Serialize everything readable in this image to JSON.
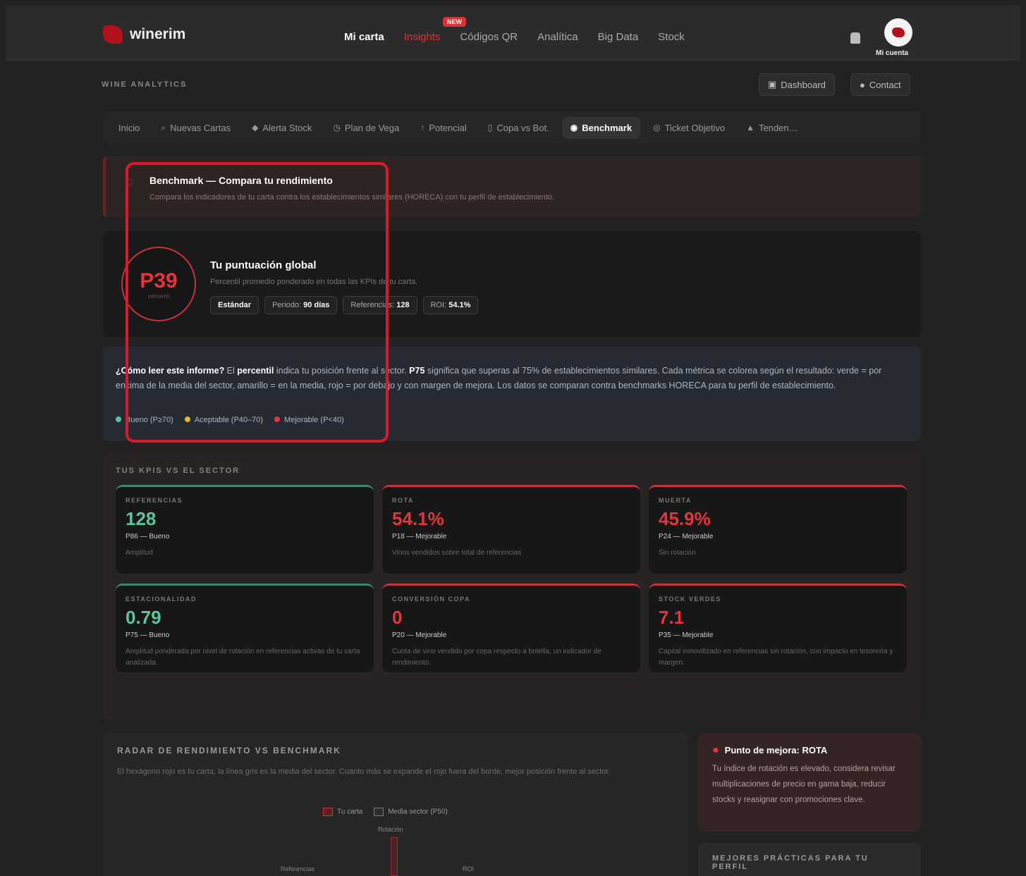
{
  "header": {
    "brand": "winerim",
    "nav": [
      "Mi carta",
      "Insights",
      "Códigos QR",
      "Analítica",
      "Big Data",
      "Stock"
    ],
    "nav_badge": "NEW",
    "account_label": "Mi cuenta"
  },
  "page": {
    "section_label": "WINE ANALYTICS",
    "dashboard_button": "Dashboard",
    "contact_button": "Contact"
  },
  "tabs": [
    {
      "label": "Inicio",
      "icon": "home-icon"
    },
    {
      "label": "Nuevas Cartas",
      "icon": "search-icon"
    },
    {
      "label": "Alerta Stock",
      "icon": "alert-icon"
    },
    {
      "label": "Plan de Vega",
      "icon": "clock-icon"
    },
    {
      "label": "Potencial",
      "icon": "arrow-icon"
    },
    {
      "label": "Copa vs Bot.",
      "icon": "glass-icon"
    },
    {
      "label": "Benchmark",
      "icon": "benchmark-icon"
    },
    {
      "label": "Ticket Objetivo",
      "icon": "ticket-icon"
    },
    {
      "label": "Tenden…",
      "icon": "trend-icon"
    }
  ],
  "banner": {
    "title": "Benchmark — Compara tu rendimiento",
    "subtitle": "Compara los indicadores de tu carta contra los establecimientos similares (HORECA) con tu perfil de establecimiento."
  },
  "score": {
    "value": "P39",
    "sub": "percentil",
    "title": "Tu puntuación global",
    "subtitle": "Percentil promedio ponderado en todas las KPIs de tu carta.",
    "chips": [
      {
        "label": "",
        "value": "Estándar"
      },
      {
        "label": "Periodo: ",
        "value": "90 días"
      },
      {
        "label": "Referencias: ",
        "value": "128"
      },
      {
        "label": "ROI: ",
        "value": "54.1%"
      }
    ]
  },
  "info": {
    "lead": "¿Cómo leer este informe?",
    "text_a": " El ",
    "term": "percentil",
    "text_b": " indica tu posición frente al sector. ",
    "example": "P75",
    "text_c": " significa que superas al 75% de establecimientos similares. Cada métrica se colorea según el resultado: verde = por encima de la media del sector, amarillo = en la media, rojo = por debajo y con margen de mejora. Los datos se comparan contra benchmarks HORECA para tu perfil de establecimiento.",
    "legend": [
      "Bueno (P≥70)",
      "Aceptable (P40–70)",
      "Mejorable (P<40)"
    ]
  },
  "kpis": {
    "title": "TUS KPIS VS EL SECTOR",
    "items": [
      {
        "label": "REFERENCIAS",
        "value": "128",
        "pct": "P86 — Bueno",
        "desc": "Amplitud",
        "status": "good"
      },
      {
        "label": "ROTA",
        "value": "54.1%",
        "pct": "P18 — Mejorable",
        "desc": "Vinos vendidos sobre total de referencias",
        "status": "bad"
      },
      {
        "label": "MUERTA",
        "value": "45.9%",
        "pct": "P24 — Mejorable",
        "desc": "Sin rotación",
        "status": "bad"
      },
      {
        "label": "ESTACIONALIDAD",
        "value": "0.79",
        "pct": "P75 — Bueno",
        "desc": "Amplitud ponderada por nivel de rotación en referencias activas de tu carta analizada.",
        "status": "good"
      },
      {
        "label": "CONVERSIÓN COPA",
        "value": "0",
        "pct": "P20 — Mejorable",
        "desc": "Cuota de vino vendido por copa respecto a botella, un indicador de rendimiento.",
        "status": "bad"
      },
      {
        "label": "STOCK VERDES",
        "value": "7.1",
        "pct": "P35 — Mejorable",
        "desc": "Capital inmovilizado en referencias sin rotación, con impacto en tesorería y margen.",
        "status": "bad"
      }
    ]
  },
  "radar": {
    "title": "RADAR DE RENDIMIENTO VS BENCHMARK",
    "subtitle": "El hexágono rojo es tu carta, la línea gris es la media del sector. Cuanto más se expande el rojo fuera del borde, mejor posición frente al sector.",
    "legend_you": "Tu carta",
    "legend_sector": "Media sector (P50)",
    "axis_top": "Rotación",
    "axis_left": "Referencias",
    "axis_right": "ROI"
  },
  "tip": {
    "title": "Punto de mejora: ROTA",
    "text": "Tu índice de rotación es elevado, considera revisar multiplicaciones de precio en gama baja, reducir stocks y reasignar con promociones clave."
  },
  "practices": {
    "title": "MEJORES PRÁCTICAS PARA TU PERFIL"
  },
  "colors": {
    "accent": "#d8323a",
    "good": "#5cc59a",
    "bad": "#e4343c",
    "highlight": "#d81b2a"
  }
}
